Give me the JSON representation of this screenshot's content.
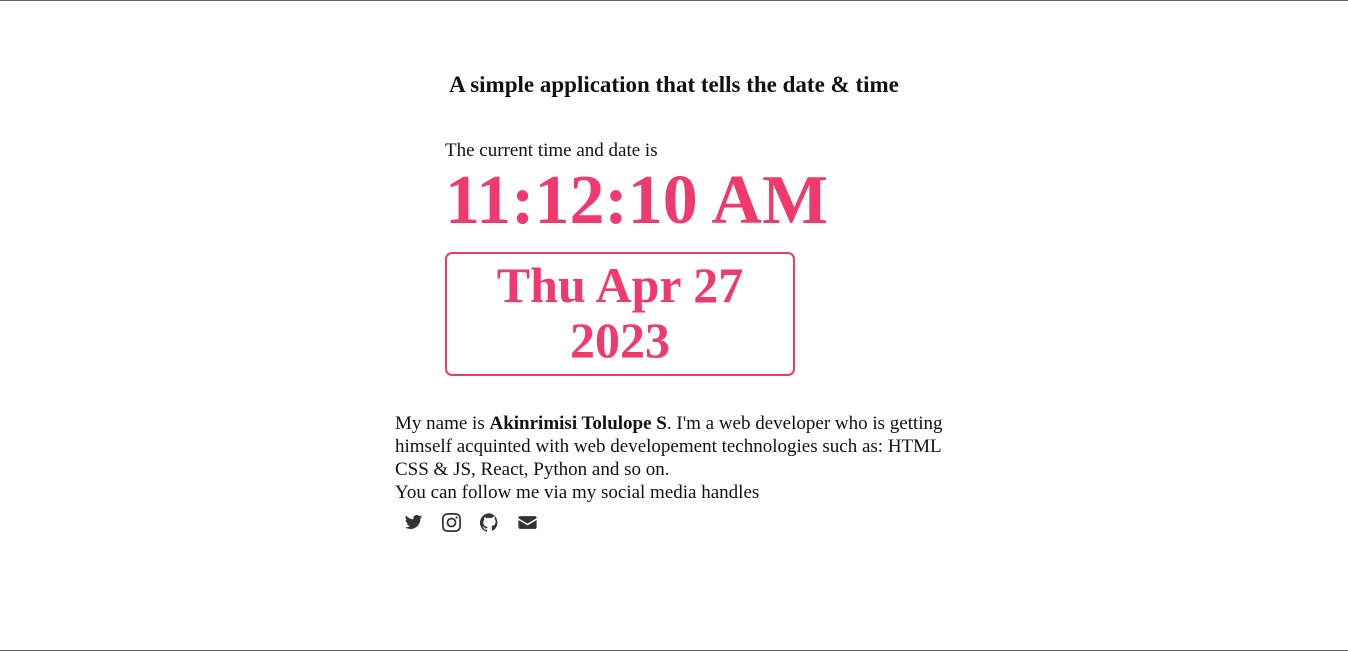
{
  "heading": "A simple application that tells the date & time",
  "clock": {
    "intro": "The current time and date is",
    "time": "11:12:10 AM",
    "date_line1": "Thu Apr 27",
    "date_line2": "2023",
    "accent_color": "#ef3a6d"
  },
  "about": {
    "prefix": "My name is ",
    "name": "Akinrimisi Tolulope S",
    "suffix": ". I'm a web developer who is getting himself acquinted with web developement technologies such as: HTML CSS & JS, React, Python and so on.",
    "follow": "You can follow me via my social media handles"
  },
  "socials": [
    {
      "icon": "twitter-icon"
    },
    {
      "icon": "instagram-icon"
    },
    {
      "icon": "github-icon"
    },
    {
      "icon": "envelope-icon"
    }
  ]
}
